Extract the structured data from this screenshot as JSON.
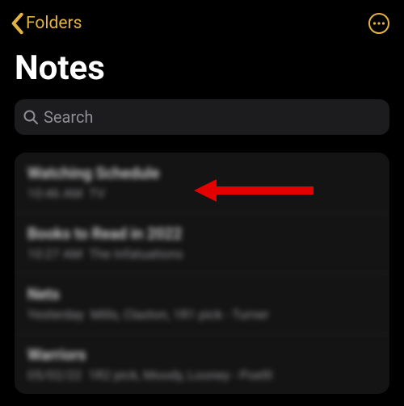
{
  "accent": "#E3B341",
  "header": {
    "back_label": "Folders"
  },
  "title": "Notes",
  "search": {
    "placeholder": "Search"
  },
  "notes": [
    {
      "title": "Watching Schedule",
      "time": "10:46 AM",
      "preview": "TV"
    },
    {
      "title": "Books to Read in 2022",
      "time": "10:27 AM",
      "preview": "The Infatuations"
    },
    {
      "title": "Nets",
      "time": "Yesterday",
      "preview": "Mills, Claxton, 1R1 pick - Turner"
    },
    {
      "title": "Warriors",
      "time": "05/02/22",
      "preview": "1R2 pick, Moody, Looney - Poeltl"
    }
  ]
}
